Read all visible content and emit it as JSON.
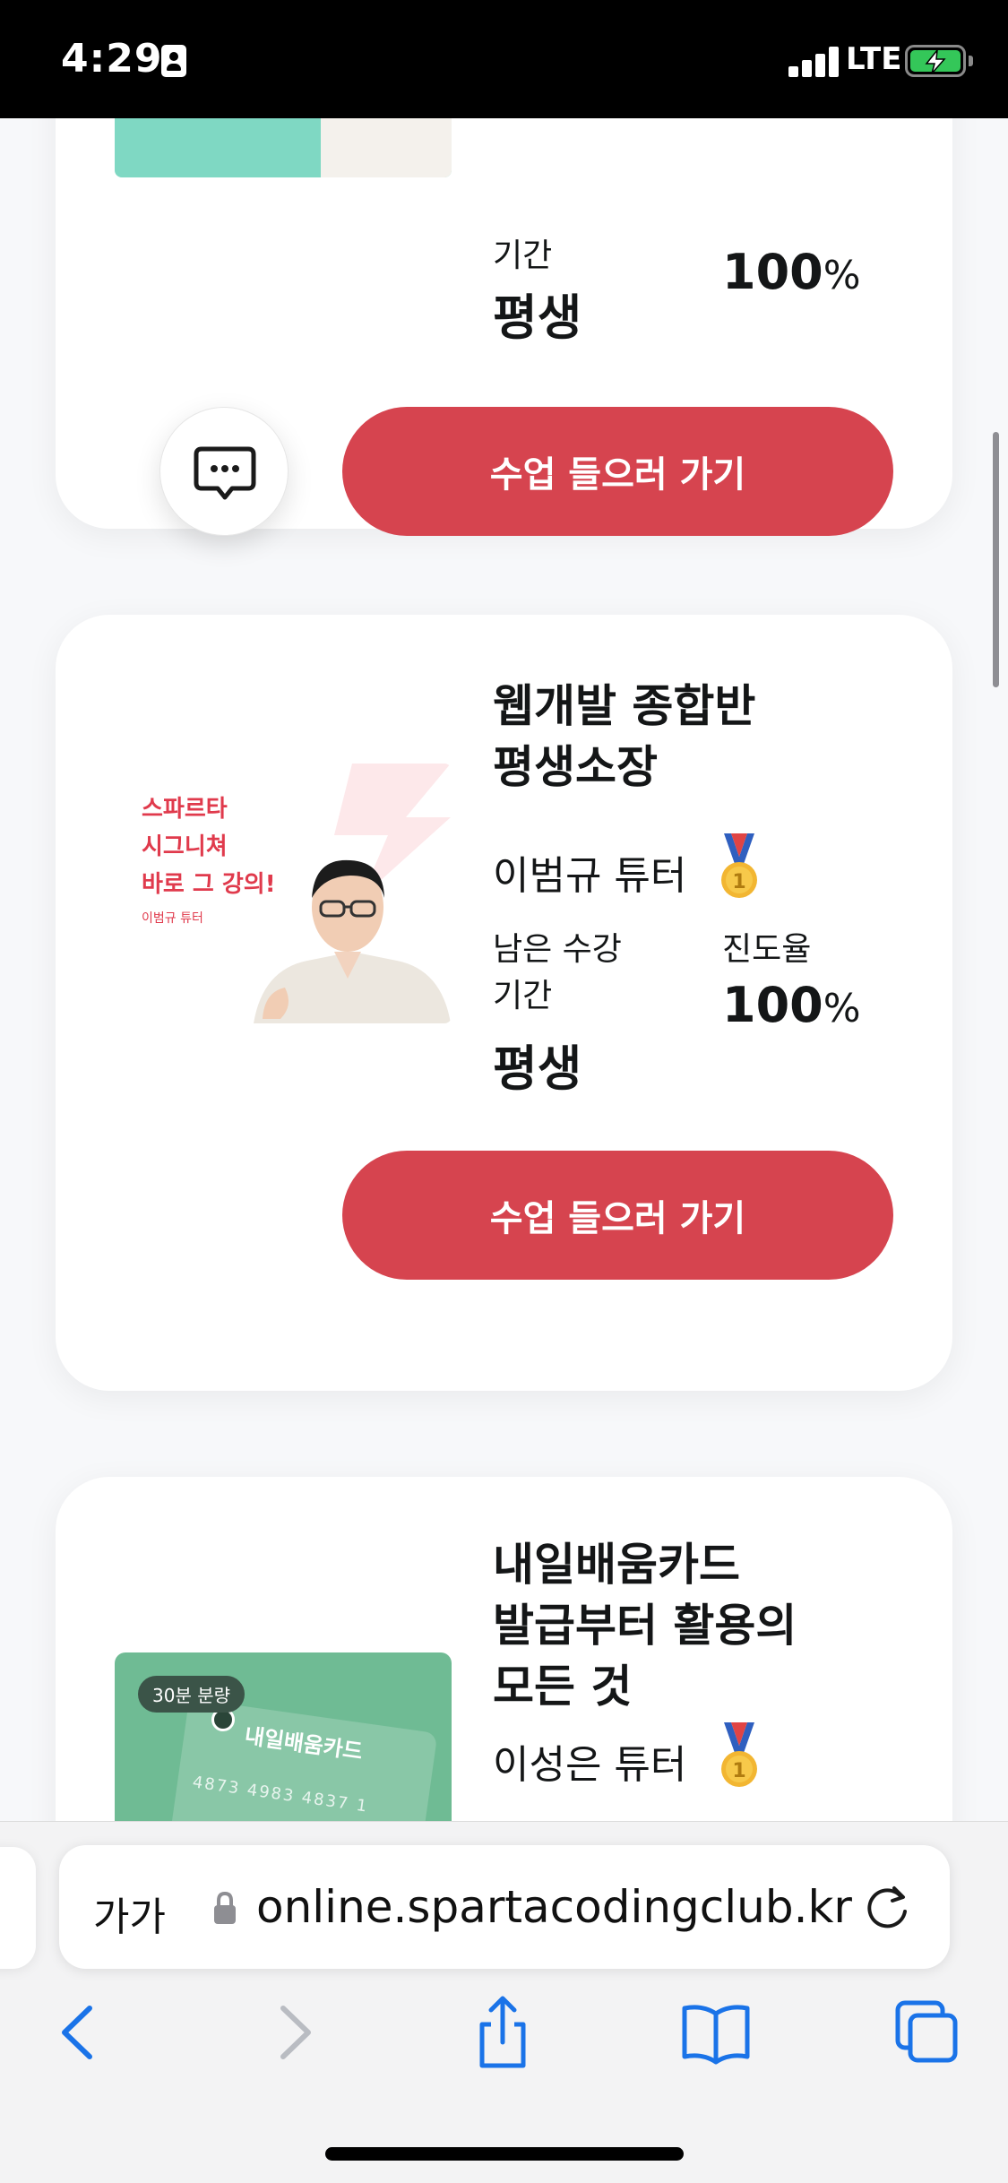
{
  "status_bar": {
    "time": "4:29",
    "network": "LTE"
  },
  "courses": [
    {
      "period_label_tail": "기간",
      "period_value": "평생",
      "progress_value": "100",
      "progress_unit": "%",
      "button_label": "수업 들으러 가기"
    },
    {
      "title_lines": [
        "웹개발 종합반",
        "평생소장"
      ],
      "tutor": "이범규 튜터",
      "thumbnail": {
        "headline_lines": [
          "스파르타",
          "시그니쳐",
          "바로 그 강의!"
        ],
        "subtext": "이범규 튜터"
      },
      "period_label_lines": [
        "남은 수강",
        "기간"
      ],
      "period_value": "평생",
      "progress_label": "진도율",
      "progress_value": "100",
      "progress_unit": "%",
      "button_label": "수업 들으러 가기"
    },
    {
      "title_lines": [
        "내일배움카드",
        "발급부터 활용의",
        "모든 것"
      ],
      "tutor": "이성은 튜터",
      "thumbnail": {
        "badge": "30분 분량",
        "card_name": "내일배움카드",
        "card_number": "4873 4983 4837 1"
      }
    }
  ],
  "browser": {
    "text_size_label": "가가",
    "url": "online.spartacodingclub.kr"
  },
  "colors": {
    "accent": "#d6444f",
    "thumb_red": "#e03a4c",
    "card_green": "#6fbb94",
    "ios_blue": "#1a73e8",
    "battery_green": "#34c759",
    "medal_gold": "#f2b632"
  }
}
